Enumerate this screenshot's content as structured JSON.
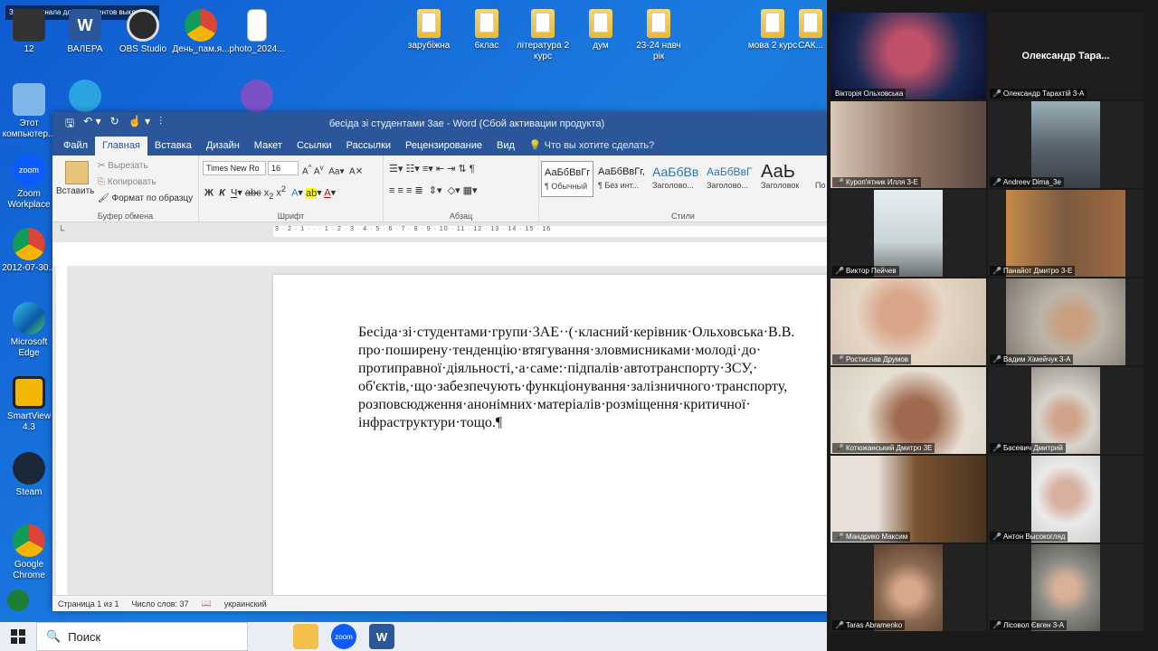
{
  "desktop": {
    "notification": "Звук оригинала для музыкантов выключен",
    "top_icons": [
      {
        "label": "12"
      },
      {
        "label": "ВАЛЕРА"
      },
      {
        "label": "OBS Studio"
      },
      {
        "label": "День_пам.я..."
      },
      {
        "label": "photo_2024..."
      },
      {
        "label": "зарубіжна"
      },
      {
        "label": "6клас"
      },
      {
        "label": "література 2 курс"
      },
      {
        "label": "дум"
      },
      {
        "label": "23-24 навч рік"
      },
      {
        "label": "мова 2 курс"
      },
      {
        "label": "САК..."
      }
    ],
    "left_icons": [
      {
        "label": "Этот компьютер..."
      },
      {
        "label": "Zoom Workplace"
      },
      {
        "label": "2012-07-30..."
      },
      {
        "label": "Microsoft Edge"
      },
      {
        "label": "SmartView 4.3"
      },
      {
        "label": "Steam"
      },
      {
        "label": "Google Chrome"
      }
    ]
  },
  "word": {
    "title": "бесіда зі студентами 3ае - Word (Сбой активации продукта)",
    "tabs": [
      "Файл",
      "Главная",
      "Вставка",
      "Дизайн",
      "Макет",
      "Ссылки",
      "Рассылки",
      "Рецензирование",
      "Вид"
    ],
    "tell_me": "Что вы хотите сделать?",
    "clipboard": {
      "paste": "Вставить",
      "cut": "Вырезать",
      "copy": "Копировать",
      "format_painter": "Формат по образцу",
      "group": "Буфер обмена"
    },
    "font": {
      "name": "Times New Ro",
      "size": "16",
      "group": "Шрифт"
    },
    "paragraph": {
      "group": "Абзац"
    },
    "styles": {
      "group": "Стили",
      "items": [
        {
          "preview": "АаБбВвГг,",
          "name": "¶ Обычный"
        },
        {
          "preview": "АаБбВвГг,",
          "name": "¶ Без инт..."
        },
        {
          "preview": "АаБбВв",
          "name": "Заголово..."
        },
        {
          "preview": "АаБбВвГ",
          "name": "Заголово..."
        },
        {
          "preview": "АаЬ",
          "name": "Заголовок"
        },
        {
          "preview": "",
          "name": "По"
        }
      ]
    },
    "ruler": "3 · 2 · 1 · · · 1 · 2 · 3 · 4 · 5 · 6 · 7 · 8 · 9 · 10 · 11 · 12 · 13 · 14 · 15 · 16",
    "document_text": "Бесіда·зі·студентами·групи·3АЕ··(·класний·керівник·Ольховська·В.В.\nпро·поширену·тенденцію·втягування·зловмисниками·молоді·до·\nпротиправної·діяльності,·а·саме:·підпалів·автотранспорту·ЗСУ,·\nоб'єктів,·що·забезпечують·функціонування·залізничного·транспорту,\nрозповсюдження·анонімних·матеріалів·розміщення·критичної·\nінфраструктури·тощо.¶",
    "status": {
      "page": "Страница 1 из 1",
      "words": "Число слов: 37",
      "language": "украинский"
    }
  },
  "zoom": {
    "participants": [
      {
        "name": "Вікторія Ольховська",
        "speaking": true
      },
      {
        "name": "Олександр Тарахтій 3-А",
        "display": "Олександр Тара..."
      },
      {
        "name": "Куроп'ятник Илля 3-Е"
      },
      {
        "name": "Andreev Dima_3е"
      },
      {
        "name": "Виктор Пейчев"
      },
      {
        "name": "Панайот Дмитро 3-Е"
      },
      {
        "name": "Ростислав Друмов"
      },
      {
        "name": "Вадим Хімейчук 3-А"
      },
      {
        "name": "Котюжанський Дмитро 3Е"
      },
      {
        "name": "Басевич Дмитрий"
      },
      {
        "name": "Мандрико Максим"
      },
      {
        "name": "Антон Высокогляд"
      },
      {
        "name": "Taras Abramenko"
      },
      {
        "name": "Лісовол Євген 3-А"
      }
    ]
  },
  "taskbar": {
    "search_placeholder": "Поиск"
  }
}
